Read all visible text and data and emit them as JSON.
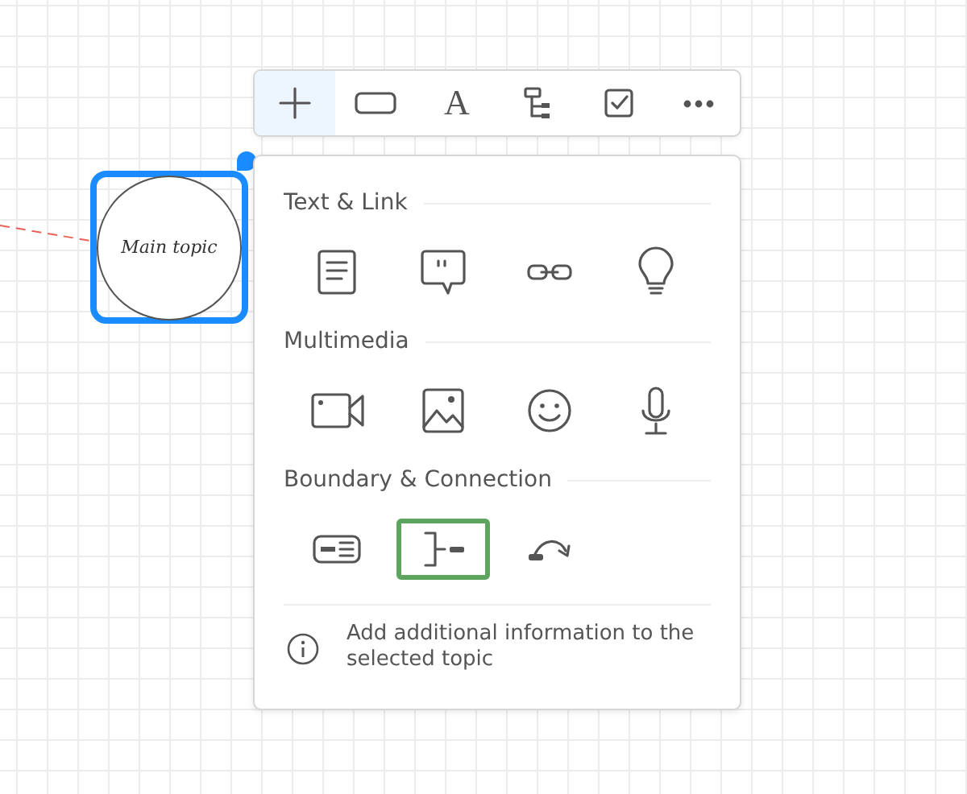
{
  "node": {
    "label": "Main topic",
    "selected": true
  },
  "toolbar": [
    {
      "kind": "add",
      "selected": true
    },
    {
      "kind": "shape",
      "selected": false
    },
    {
      "kind": "glyph",
      "label": "A",
      "selected": false
    },
    {
      "kind": "structure",
      "selected": false
    },
    {
      "kind": "task",
      "selected": false
    },
    {
      "kind": "more",
      "selected": false
    }
  ],
  "sections": [
    {
      "title": "Text & Link",
      "items": [
        {
          "kind": "note",
          "selected": false
        },
        {
          "kind": "comment",
          "selected": false
        },
        {
          "kind": "link",
          "selected": false
        },
        {
          "kind": "idea",
          "selected": false
        }
      ]
    },
    {
      "title": "Multimedia",
      "items": [
        {
          "kind": "video",
          "selected": false
        },
        {
          "kind": "image",
          "selected": false
        },
        {
          "kind": "emoji",
          "selected": false
        },
        {
          "kind": "audio",
          "selected": false
        }
      ]
    },
    {
      "title": "Boundary & Connection",
      "items": [
        {
          "kind": "boundary",
          "selected": false
        },
        {
          "kind": "summary",
          "selected": true
        },
        {
          "kind": "relationship",
          "selected": false
        }
      ]
    }
  ],
  "hint": "Add additional information to the selected topic"
}
